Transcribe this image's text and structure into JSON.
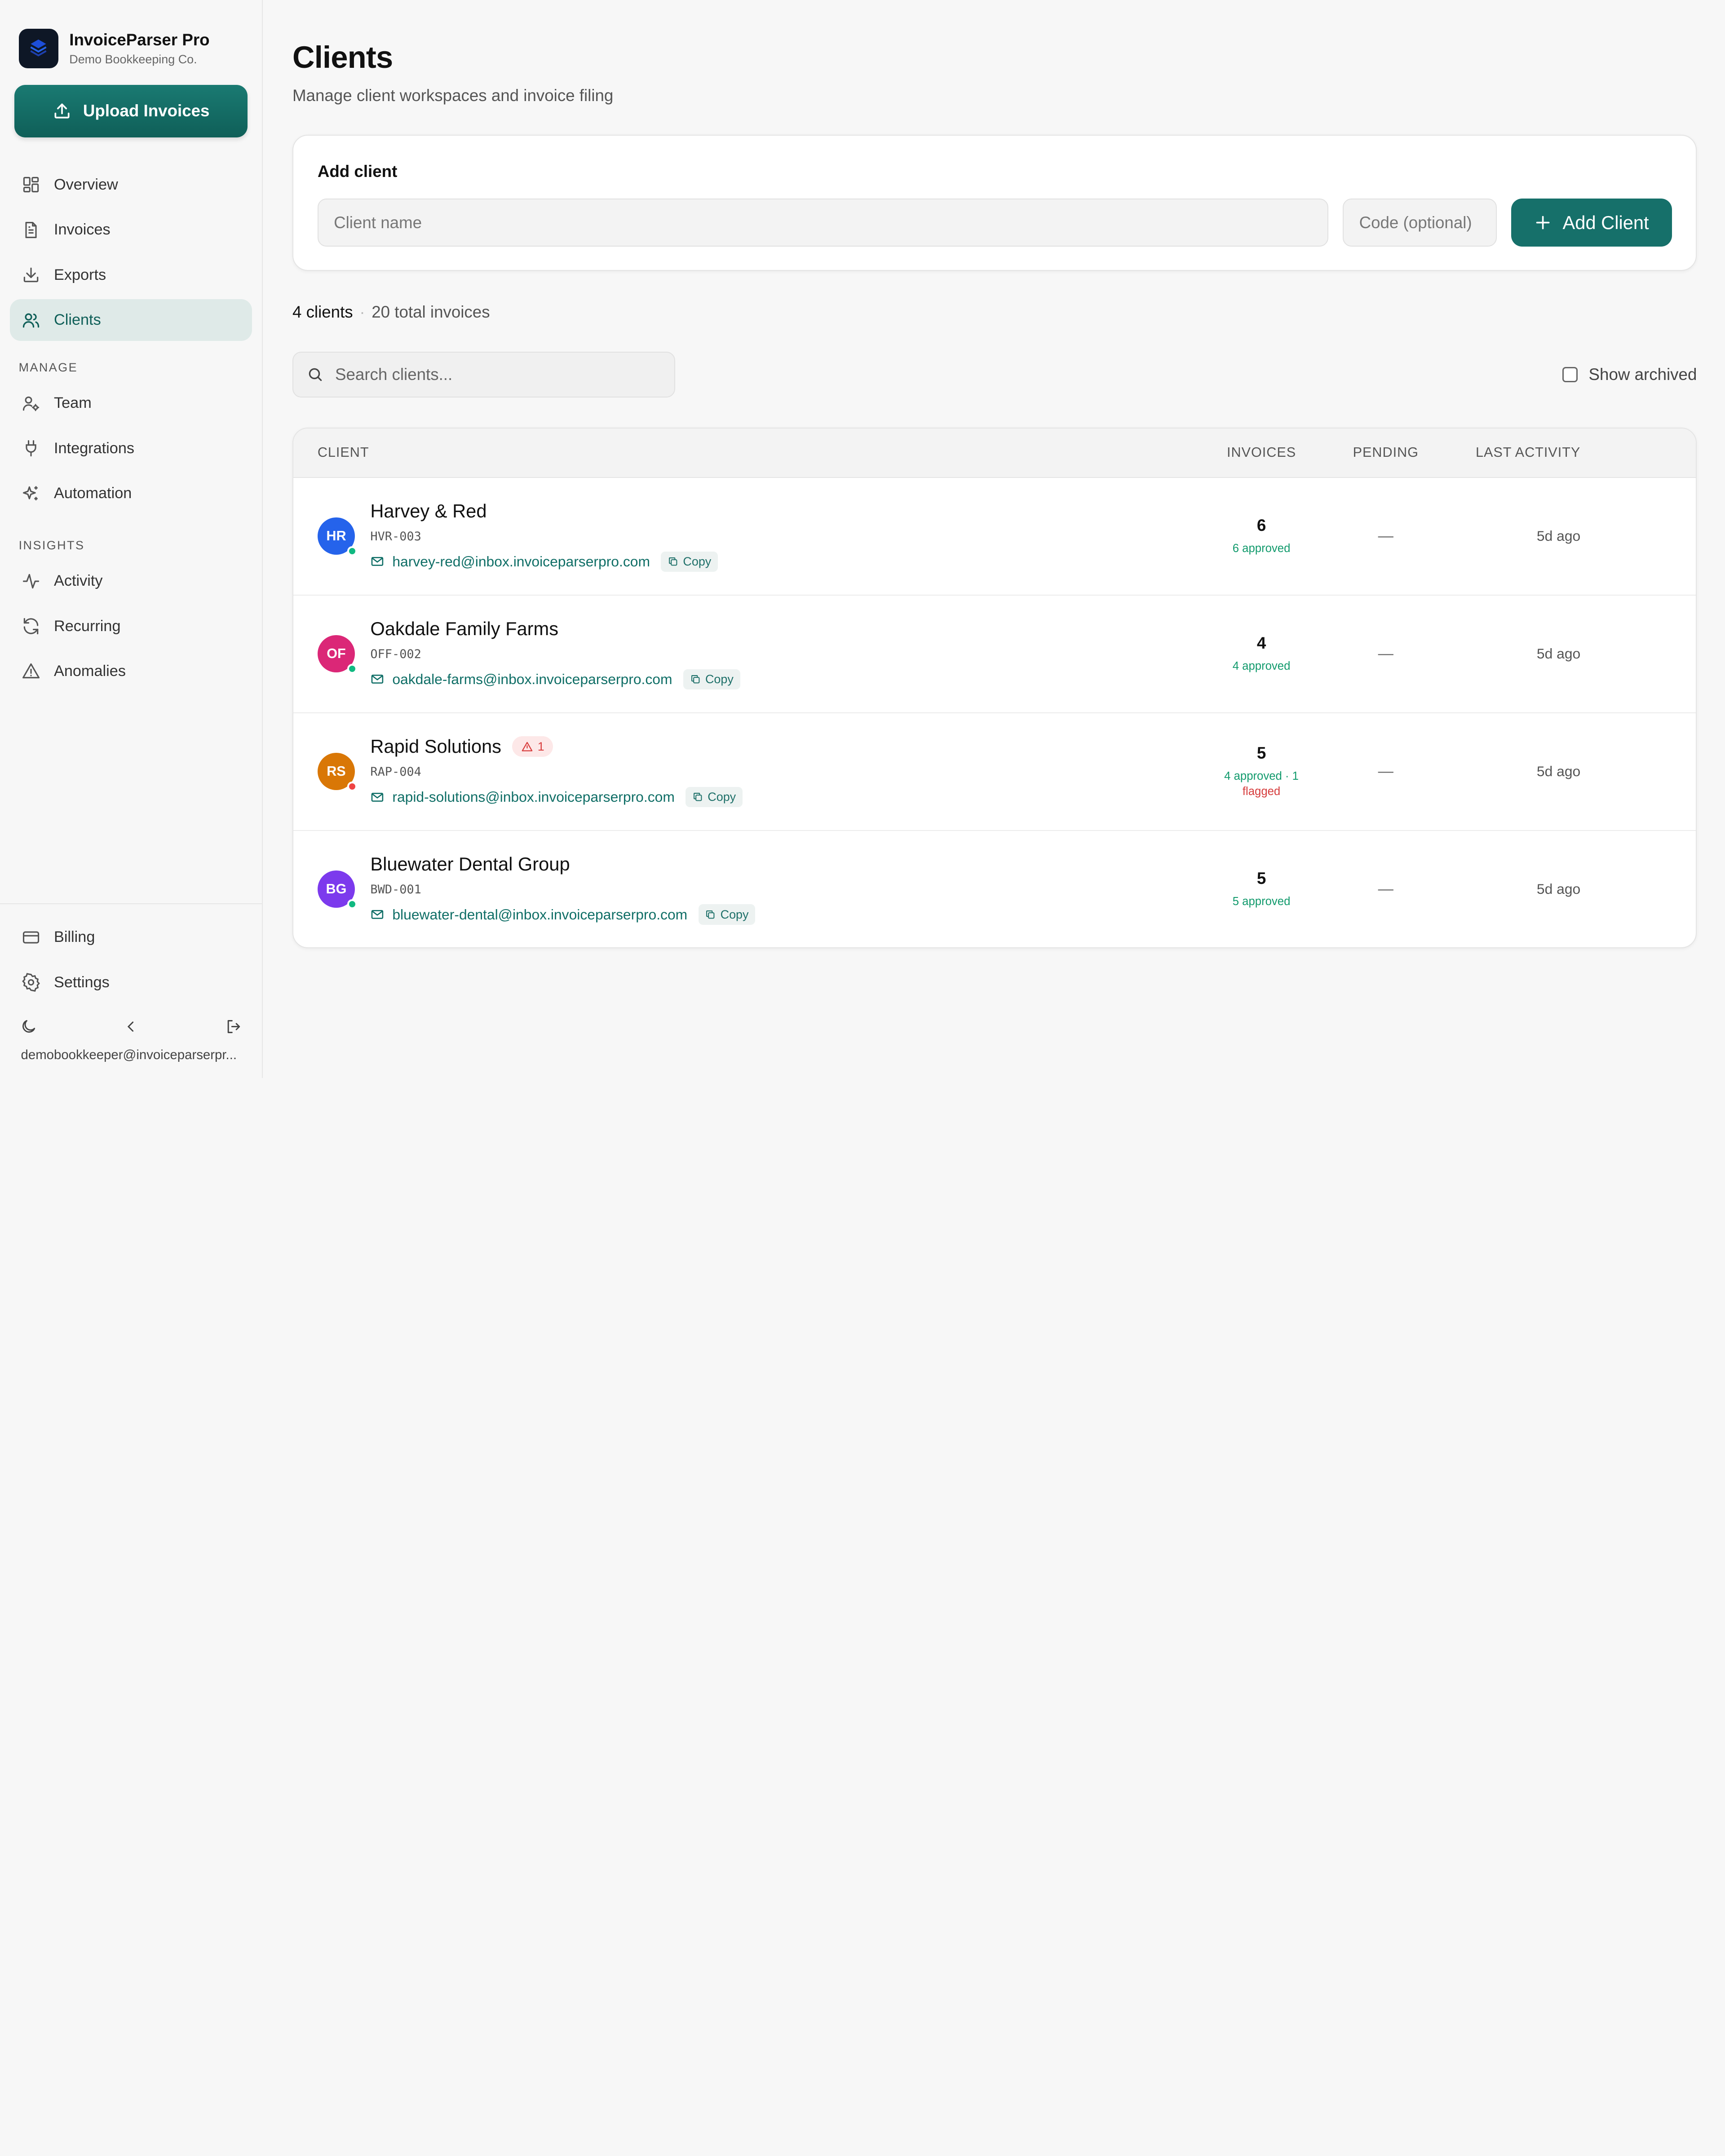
{
  "brand": {
    "name": "InvoiceParser Pro",
    "org": "Demo Bookkeeping Co."
  },
  "upload_label": "Upload Invoices",
  "nav": {
    "main": [
      {
        "label": "Overview",
        "icon": "grid-icon"
      },
      {
        "label": "Invoices",
        "icon": "document-icon"
      },
      {
        "label": "Exports",
        "icon": "download-icon"
      },
      {
        "label": "Clients",
        "icon": "users-icon",
        "active": true
      }
    ],
    "manage_label": "MANAGE",
    "manage": [
      {
        "label": "Team",
        "icon": "user-settings-icon"
      },
      {
        "label": "Integrations",
        "icon": "plug-icon"
      },
      {
        "label": "Automation",
        "icon": "sparkles-icon"
      }
    ],
    "insights_label": "INSIGHTS",
    "insights": [
      {
        "label": "Activity",
        "icon": "activity-icon"
      },
      {
        "label": "Recurring",
        "icon": "refresh-icon"
      },
      {
        "label": "Anomalies",
        "icon": "warning-icon"
      }
    ],
    "bottom": [
      {
        "label": "Billing",
        "icon": "credit-card-icon"
      },
      {
        "label": "Settings",
        "icon": "gear-icon"
      }
    ]
  },
  "user_email": "demobookkeeper@invoiceparserpr...",
  "page": {
    "title": "Clients",
    "subtitle": "Manage client workspaces and invoice filing"
  },
  "add_client": {
    "title": "Add client",
    "name_placeholder": "Client name",
    "code_placeholder": "Code (optional)",
    "button_label": "Add Client"
  },
  "summary": {
    "clients": "4 clients",
    "separator": "·",
    "invoices": "20 total invoices"
  },
  "search_placeholder": "Search clients...",
  "show_archived_label": "Show archived",
  "table": {
    "headers": {
      "client": "CLIENT",
      "invoices": "INVOICES",
      "pending": "PENDING",
      "last_activity": "LAST ACTIVITY"
    },
    "copy_label": "Copy",
    "rows": [
      {
        "initials": "HR",
        "avatar_color": "#2563eb",
        "status_color": "#10b981",
        "name": "Harvey & Red",
        "code": "HVR-003",
        "email": "harvey-red@inbox.invoiceparserpro.com",
        "invoices": "6",
        "approved": "6 approved",
        "flagged": "",
        "flag_count": "",
        "pending": "—",
        "last_activity": "5d ago"
      },
      {
        "initials": "OF",
        "avatar_color": "#db2777",
        "status_color": "#10b981",
        "name": "Oakdale Family Farms",
        "code": "OFF-002",
        "email": "oakdale-farms@inbox.invoiceparserpro.com",
        "invoices": "4",
        "approved": "4 approved",
        "flagged": "",
        "flag_count": "",
        "pending": "—",
        "last_activity": "5d ago"
      },
      {
        "initials": "RS",
        "avatar_color": "#d97706",
        "status_color": "#ef4444",
        "name": "Rapid Solutions",
        "code": "RAP-004",
        "email": "rapid-solutions@inbox.invoiceparserpro.com",
        "invoices": "5",
        "approved": "4 approved · 1",
        "flagged": "flagged",
        "flag_count": "1",
        "pending": "—",
        "last_activity": "5d ago"
      },
      {
        "initials": "BG",
        "avatar_color": "#7c3aed",
        "status_color": "#10b981",
        "name": "Bluewater Dental Group",
        "code": "BWD-001",
        "email": "bluewater-dental@inbox.invoiceparserpro.com",
        "invoices": "5",
        "approved": "5 approved",
        "flagged": "",
        "flag_count": "",
        "pending": "—",
        "last_activity": "5d ago"
      }
    ]
  }
}
